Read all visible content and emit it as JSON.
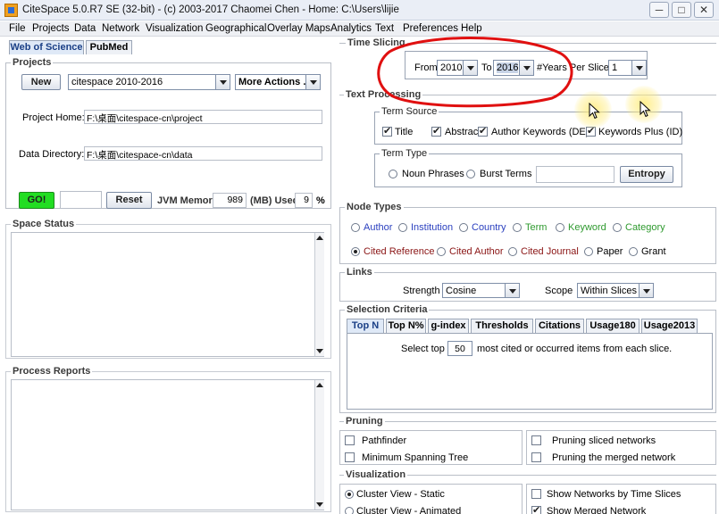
{
  "window": {
    "title": "CiteSpace 5.0.R7 SE (32-bit) - (c) 2003-2017 Chaomei Chen - Home: C:\\Users\\lijie",
    "controls": {
      "minimize": "─",
      "maximize": "□",
      "close": "✕"
    }
  },
  "menu": [
    "File",
    "Projects",
    "Data",
    "Network",
    "Visualization",
    "Geographical",
    "Overlay Maps",
    "Analytics",
    "Text",
    "Preferences",
    "Help"
  ],
  "left": {
    "tabs": [
      "Web of Science",
      "PubMed"
    ],
    "projects": {
      "label": "Projects",
      "new_button": "New",
      "project_select": "citespace 2010-2016",
      "more_actions": "More Actions ...",
      "home_label": "Project Home:",
      "home_value": "F:\\桌面\\citespace-cn\\project",
      "data_label": "Data Directory:",
      "data_value": "F:\\桌面\\citespace-cn\\data"
    },
    "run": {
      "go_button": "GO!",
      "reset_button": "Reset",
      "jvm_label": "JVM Memory",
      "jvm_value": "989",
      "mb_used_label": "(MB) Used",
      "used_value": "9",
      "percent": "%",
      "go_color": "#22dd22"
    },
    "space_status": "Space Status",
    "process_reports": "Process Reports"
  },
  "time_slicing": {
    "label": "Time Slicing",
    "from_label": "From",
    "from_value": "2010",
    "to_label": "To",
    "to_value": "2016",
    "per_slice_label": "#Years Per Slice",
    "per_slice_value": "1"
  },
  "text_processing": {
    "label": "Text Processing",
    "term_source": {
      "label": "Term Source",
      "options": [
        {
          "label": "Title",
          "checked": true
        },
        {
          "label": "Abstract",
          "checked": true
        },
        {
          "label": "Author Keywords (DE)",
          "checked": true
        },
        {
          "label": "Keywords Plus (ID)",
          "checked": true
        }
      ]
    },
    "term_type": {
      "label": "Term Type",
      "noun_phrases": "Noun Phrases",
      "burst_terms": "Burst Terms",
      "entropy_button": "Entropy"
    }
  },
  "node_types": {
    "label": "Node Types",
    "row1": [
      {
        "label": "Author",
        "color": "#2a3fbf"
      },
      {
        "label": "Institution",
        "color": "#2a3fbf"
      },
      {
        "label": "Country",
        "color": "#2a3fbf"
      },
      {
        "label": "Term",
        "color": "#2f9a2f"
      },
      {
        "label": "Keyword",
        "color": "#2f9a2f"
      },
      {
        "label": "Category",
        "color": "#2f9a2f"
      }
    ],
    "row2": [
      {
        "label": "Cited Reference",
        "color": "#8a1414",
        "selected": true
      },
      {
        "label": "Cited Author",
        "color": "#8a1414"
      },
      {
        "label": "Cited Journal",
        "color": "#8a1414"
      },
      {
        "label": "Paper",
        "color": "#222222"
      },
      {
        "label": "Grant",
        "color": "#222222"
      }
    ]
  },
  "links": {
    "label": "Links",
    "strength_label": "Strength",
    "strength_value": "Cosine",
    "scope_label": "Scope",
    "scope_value": "Within Slices"
  },
  "selection": {
    "label": "Selection Criteria",
    "tabs": [
      "Top N",
      "Top N%",
      "g-index",
      "Thresholds",
      "Citations",
      "Usage180",
      "Usage2013"
    ],
    "select_top_label": "Select top",
    "top_value": "50",
    "suffix": "most cited or occurred items from each slice."
  },
  "pruning": {
    "label": "Pruning",
    "options": [
      "Pathfinder",
      "Pruning sliced networks",
      "Minimum Spanning Tree",
      "Pruning the merged network"
    ]
  },
  "visualization": {
    "label": "Visualization",
    "options": [
      {
        "label": "Cluster View - Static",
        "selected": true
      },
      {
        "label": "Show Networks by Time Slices",
        "checked": false
      },
      {
        "label": "Cluster View - Animated",
        "selected": false
      },
      {
        "label": "Show Merged Network",
        "checked": true
      }
    ]
  },
  "colors": {
    "annotation": "#e01010",
    "tab_active_text": "#1a3f86"
  }
}
